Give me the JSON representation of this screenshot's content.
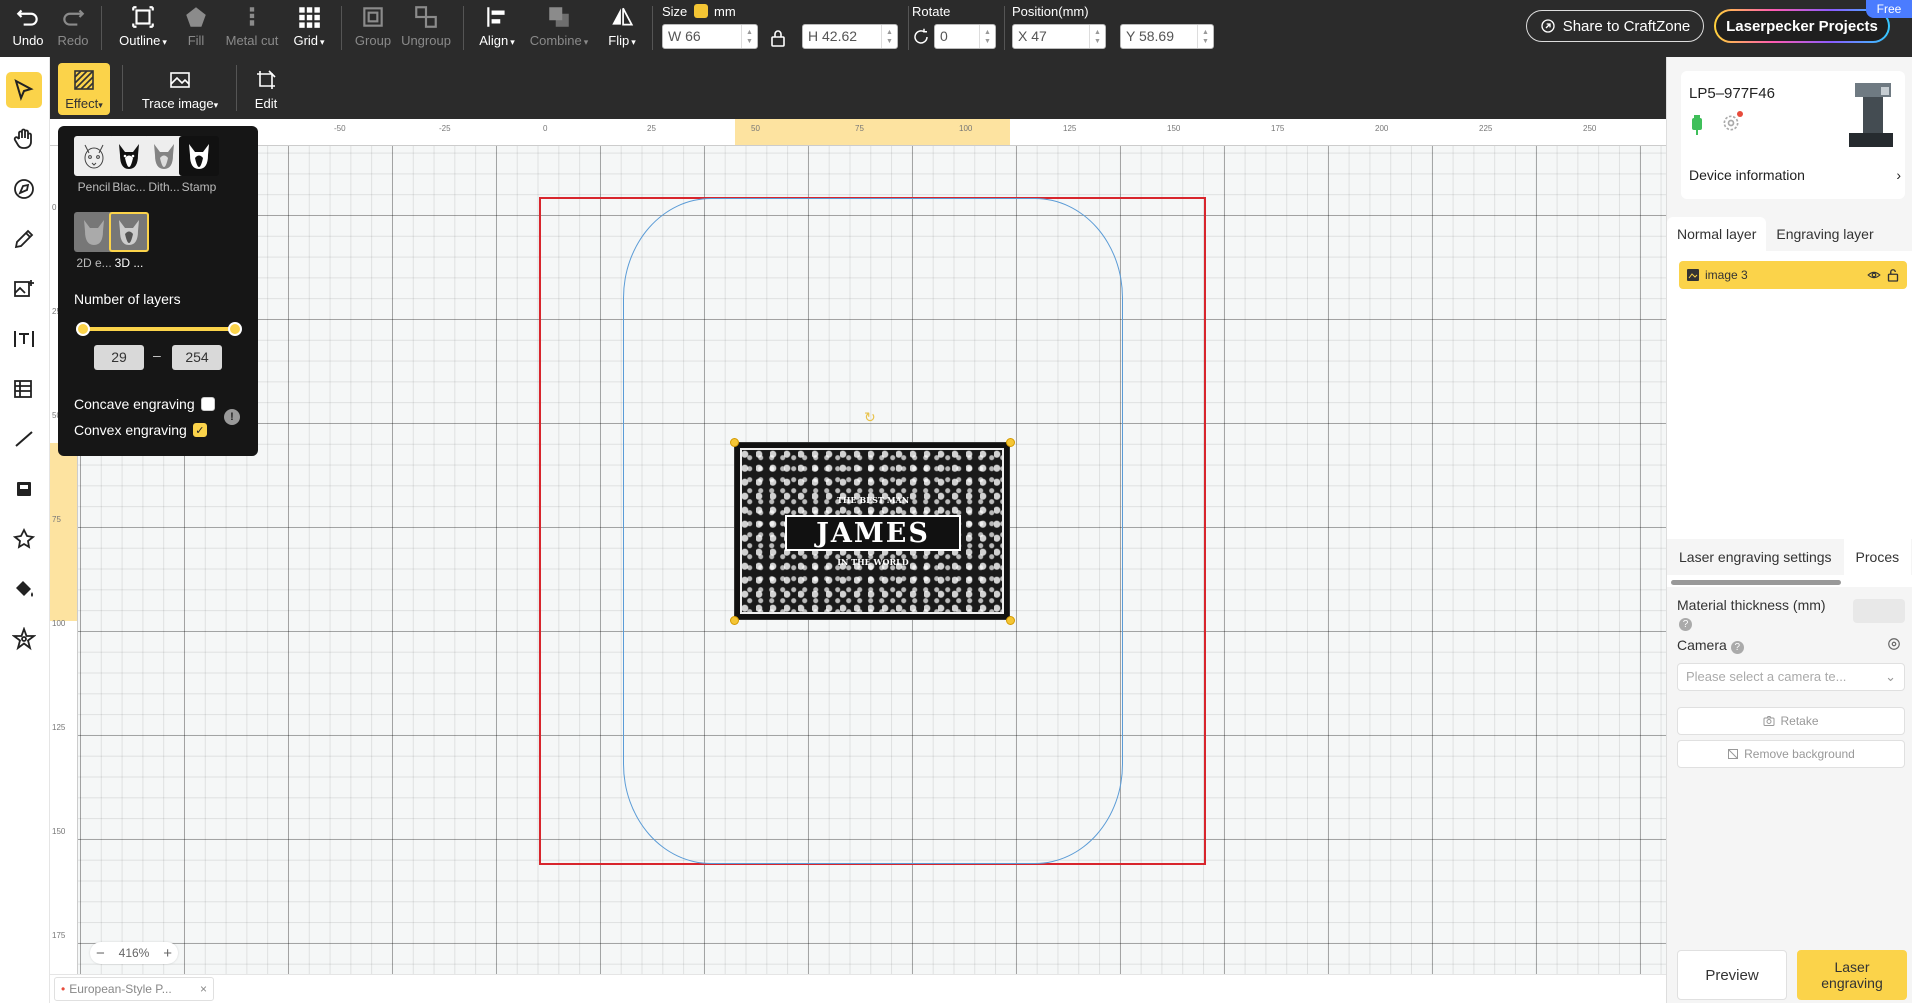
{
  "toolbar": {
    "undo": "Undo",
    "redo": "Redo",
    "outline": "Outline",
    "fill": "Fill",
    "metal_cut": "Metal cut",
    "grid": "Grid",
    "group": "Group",
    "ungroup": "Ungroup",
    "align": "Align",
    "combine": "Combine",
    "flip": "Flip"
  },
  "props": {
    "size_label": "Size",
    "unit": "mm",
    "width": "W 66",
    "height": "H 42.62",
    "rotate_label": "Rotate",
    "rotate_value": "0",
    "position_label": "Position(mm)",
    "x": "X 47",
    "y": "Y 58.69"
  },
  "header": {
    "share": "Share to CraftZone",
    "projects": "Laserpecker Projects",
    "free_badge": "Free"
  },
  "subbar": {
    "effect": "Effect",
    "trace": "Trace image",
    "edit": "Edit"
  },
  "effect_panel": {
    "effects": [
      "Pencil",
      "Blac...",
      "Dith...",
      "Stamp",
      "2D e...",
      "3D ..."
    ],
    "layers_title": "Number of layers",
    "range_min": "29",
    "range_max": "254",
    "concave": "Concave engraving",
    "concave_checked": false,
    "convex": "Convex engraving",
    "convex_checked": true
  },
  "rulers": {
    "top": [
      "-50",
      "-25",
      "0",
      "25",
      "50",
      "75",
      "100",
      "125",
      "150",
      "175",
      "200",
      "225",
      "250"
    ],
    "left": [
      "0",
      "25",
      "50",
      "75",
      "100",
      "125",
      "150",
      "175"
    ]
  },
  "artwork": {
    "name": "JAMES",
    "top_text": "THE BEST MAN",
    "bottom_text": "IN THE WORLD"
  },
  "zoom": {
    "level": "416%",
    "minus": "−",
    "plus": "+"
  },
  "document": {
    "tab_name": "European-Style P..."
  },
  "device": {
    "name": "LP5–977F46",
    "info_link": "Device information"
  },
  "layers": {
    "tabs": [
      "Normal layer",
      "Engraving layer"
    ],
    "items": [
      {
        "name": "image 3"
      }
    ]
  },
  "settings": {
    "tabs": [
      "Laser engraving settings",
      "Proces"
    ],
    "thickness_label": "Material thickness (mm)",
    "camera_label": "Camera",
    "camera_placeholder": "Please select a camera te...",
    "retake": "Retake",
    "remove_bg": "Remove background"
  },
  "actions": {
    "preview": "Preview",
    "laser": "Laser engraving"
  },
  "colors": {
    "accent": "#fbd34a",
    "toolbar_bg": "#2b2b2b",
    "frame_red": "#d8252c",
    "frame_blue": "#5a9bd6"
  }
}
